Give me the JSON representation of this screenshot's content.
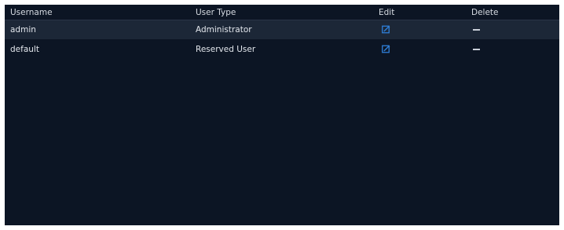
{
  "table": {
    "columns": {
      "username": "Username",
      "user_type": "User Type",
      "edit": "Edit",
      "delete": "Delete"
    },
    "rows": [
      {
        "username": "admin",
        "user_type": "Administrator",
        "edit_icon": "edit-icon",
        "delete_icon": "dash-icon"
      },
      {
        "username": "default",
        "user_type": "Reserved User",
        "edit_icon": "edit-icon",
        "delete_icon": "dash-icon"
      }
    ]
  },
  "colors": {
    "background": "#0c1524",
    "selected_row": "#1c2737",
    "edit_icon": "#2f7fd8",
    "text": "#e2e6ec"
  }
}
